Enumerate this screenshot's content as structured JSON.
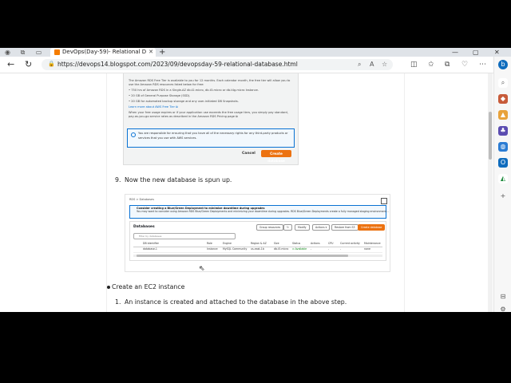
{
  "browser": {
    "tab_title": "DevOps(Day-59)- Relational Datab",
    "url": "https://devops14.blogspot.com/2023/09/devopsday-59-relational-database.html",
    "window_controls": [
      "—",
      "▢",
      "✕"
    ]
  },
  "screenshot1": {
    "lines": [
      "The Amazon RDS Free Tier is available to you for 12 months. Each calendar month, the free tier will allow you to",
      "use the Amazon RDS resources listed below for free:",
      "• 750 hrs of Amazon RDS in a Single-AZ db.t2.micro, db.t3.micro or db.t4g.micro Instance.",
      "• 20 GB of General Purpose Storage (SSD).",
      "• 20 GB for automated backup storage and any user-initiated DB Snapshots.",
      "Learn more about AWS Free Tier ⧉",
      "When your free usage expires or if your application use exceeds the free usage tiers, you simply pay standard,",
      "pay-as-you-go service rates as described in the Amazon RDS Pricing page ⧉"
    ],
    "info_line1": "You are responsible for ensuring that you have all of the necessary rights for any third-party products or",
    "info_line2": "services that you use with AWS services.",
    "cancel_label": "Cancel",
    "create_label": "Create database"
  },
  "step9": {
    "number": "9.",
    "text": "Now the new database is spun up."
  },
  "screenshot2": {
    "breadcrumb": "RDS  >  Databases",
    "banner_line1": "Consider creating a Blue/Green Deployment to minimize downtime during upgrades",
    "banner_line2": "You may want to consider using Amazon RDS Blue/Green Deployments and minimizing your downtime during upgrades. RDS Blue/Green Deployments create a fully managed staging environment...",
    "panel_title": "Databases",
    "actions": [
      "Group resources",
      "↻",
      "Modify",
      "Actions ▾",
      "Restore from S3",
      "Create database"
    ],
    "search_placeholder": "Filter by databases",
    "columns": [
      "DB identifier",
      "Role",
      "Engine",
      "Region & AZ",
      "Size",
      "Status",
      "Actions",
      "CPU",
      "Current activity",
      "Maintenance"
    ],
    "row": [
      "database-1",
      "Instance",
      "MySQL Community",
      "us-east-1b",
      "db.t3.micro",
      "⊙ Available",
      "-",
      "-",
      "-",
      "none"
    ]
  },
  "bullet_item": "Create an EC2 instance",
  "step1": {
    "number": "1.",
    "text": "An instance is created and attached to the database in the above step."
  }
}
